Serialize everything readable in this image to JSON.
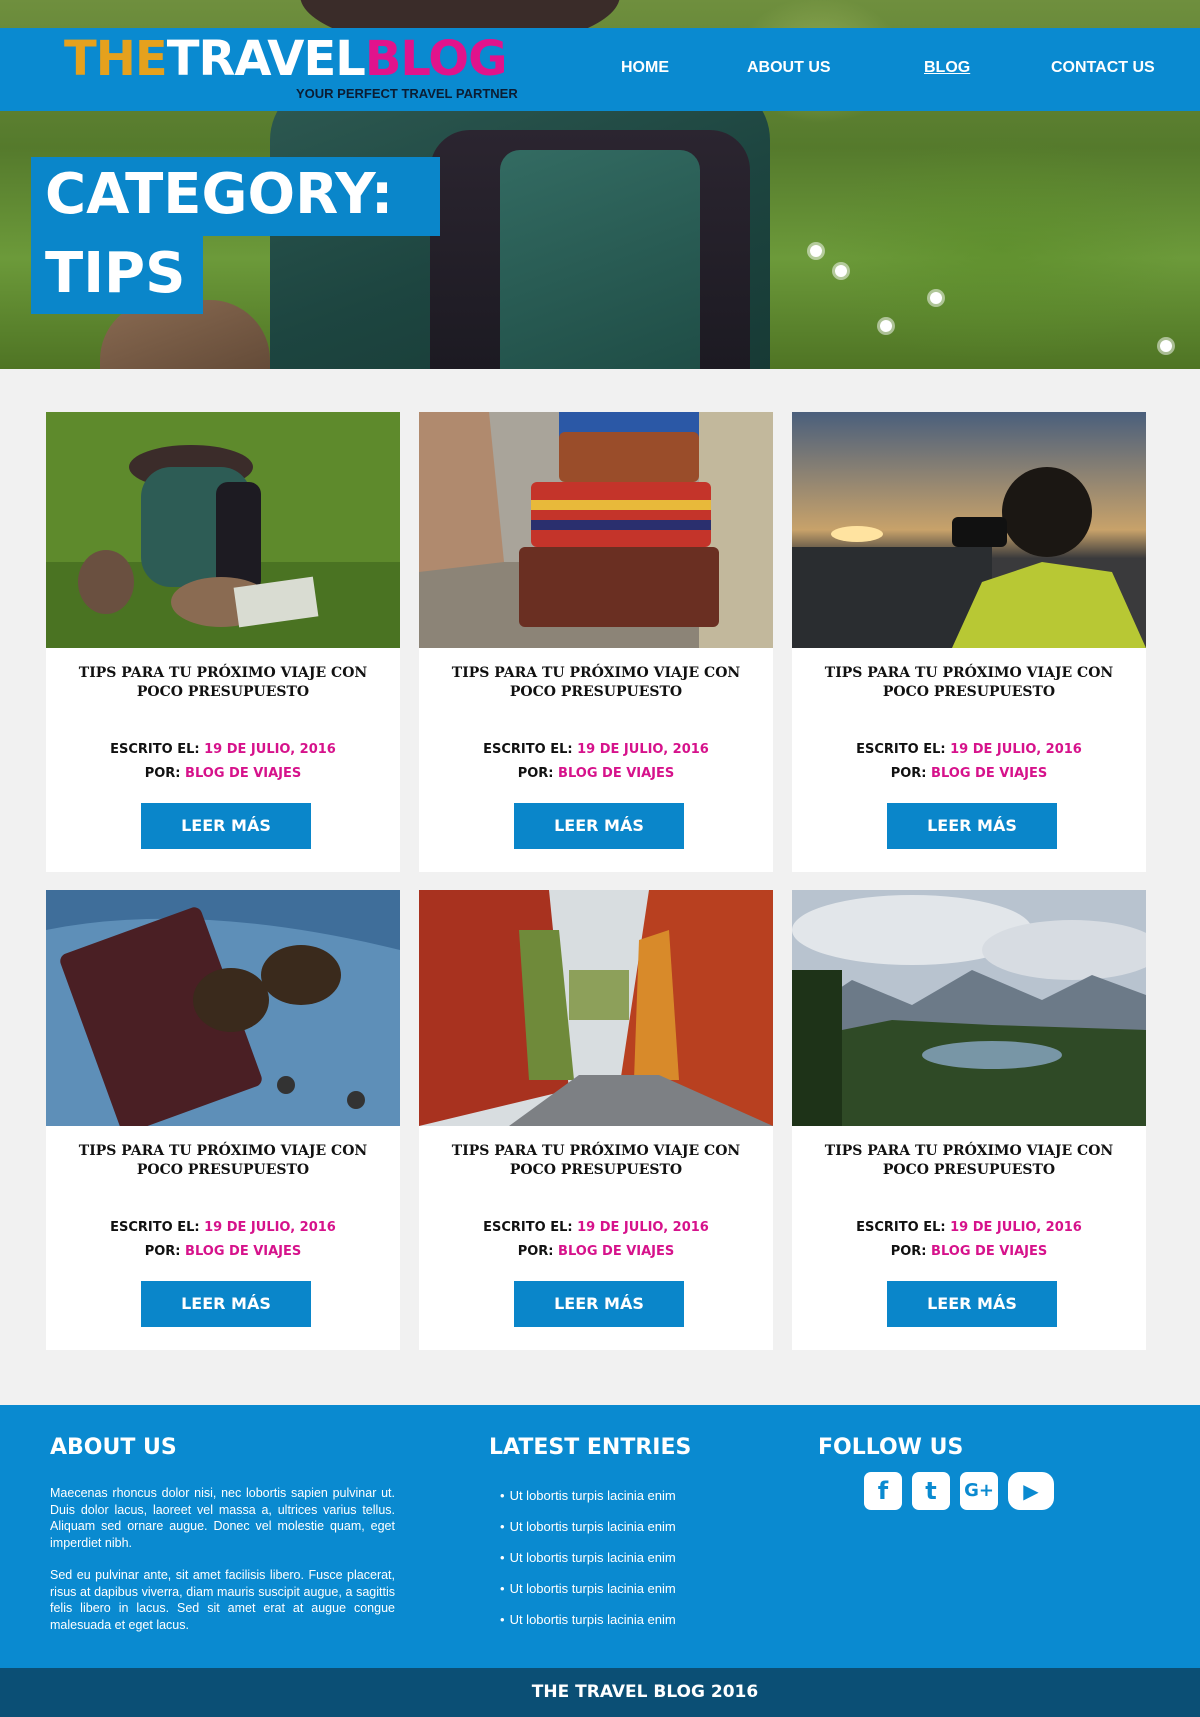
{
  "colors": {
    "primary_blue": "#0a8ad0",
    "dark_footer": "#0b4f75",
    "accent_pink": "#d6128b",
    "logo_gold": "#e5a11d",
    "logo_pink": "#e1138c"
  },
  "header": {
    "logo": {
      "the": "THE",
      "travel": "TRAVEL",
      "blog": "BLOG",
      "tagline": "YOUR PERFECT TRAVEL PARTNER"
    },
    "nav": [
      {
        "label": "HOME",
        "active": false
      },
      {
        "label": "ABOUT US",
        "active": false
      },
      {
        "label": "BLOG",
        "active": true
      },
      {
        "label": "CONTACT US",
        "active": false
      }
    ]
  },
  "hero": {
    "line1": "CATEGORY:",
    "line2": "TIPS"
  },
  "posts": [
    {
      "title": "TIPS PARA TU PRÓXIMO VIAJE  CON POCO PRESUPUESTO",
      "written_label": "ESCRITO EL:",
      "date": "19 DE JULIO, 2016",
      "by_label": "POR:",
      "author": "BLOG DE VIAJES",
      "button": "LEER MÁS",
      "image_icon": "backpack-boots-photo"
    },
    {
      "title": "TIPS PARA TU PRÓXIMO VIAJE  CON POCO PRESUPUESTO",
      "written_label": "ESCRITO EL:",
      "date": "19 DE JULIO, 2016",
      "by_label": "POR:",
      "author": "BLOG DE VIAJES",
      "button": "LEER MÁS",
      "image_icon": "suitcases-photo"
    },
    {
      "title": "TIPS PARA TU PRÓXIMO VIAJE  CON POCO PRESUPUESTO",
      "written_label": "ESCRITO EL:",
      "date": "19 DE JULIO, 2016",
      "by_label": "POR:",
      "author": "BLOG DE VIAJES",
      "button": "LEER MÁS",
      "image_icon": "photographer-sunset-photo"
    },
    {
      "title": "TIPS PARA TU PRÓXIMO VIAJE  CON POCO PRESUPUESTO",
      "written_label": "ESCRITO EL:",
      "date": "19 DE JULIO, 2016",
      "by_label": "POR:",
      "author": "BLOG DE VIAJES",
      "button": "LEER MÁS",
      "image_icon": "passport-sunglasses-photo"
    },
    {
      "title": "TIPS PARA TU PRÓXIMO VIAJE  CON POCO PRESUPUESTO",
      "written_label": "ESCRITO EL:",
      "date": "19 DE JULIO, 2016",
      "by_label": "POR:",
      "author": "BLOG DE VIAJES",
      "button": "LEER MÁS",
      "image_icon": "autumn-road-photo"
    },
    {
      "title": "TIPS PARA TU PRÓXIMO VIAJE  CON POCO PRESUPUESTO",
      "written_label": "ESCRITO EL:",
      "date": "19 DE JULIO, 2016",
      "by_label": "POR:",
      "author": "BLOG DE VIAJES",
      "button": "LEER MÁS",
      "image_icon": "mountain-lake-photo"
    }
  ],
  "footer": {
    "about": {
      "heading": "ABOUT US",
      "p1": "Maecenas rhoncus dolor nisi, nec lobortis sapien pulvinar ut. Duis dolor lacus, laoreet vel massa a, ultrices varius tellus. Aliquam sed ornare augue. Donec vel molestie quam, eget imperdiet nibh.",
      "p2": "Sed eu pulvinar ante, sit amet facilisis libero. Fusce placerat, risus at dapibus viverra, diam mauris suscipit augue, a sagittis felis libero in lacus. Sed sit amet erat at augue congue malesuada et eget lacus."
    },
    "latest": {
      "heading": "LATEST ENTRIES",
      "items": [
        "Ut lobortis turpis lacinia enim",
        "Ut lobortis turpis lacinia enim",
        "Ut lobortis turpis lacinia enim",
        "Ut lobortis turpis lacinia enim",
        "Ut lobortis turpis lacinia enim"
      ]
    },
    "follow": {
      "heading": "FOLLOW US",
      "icons": [
        {
          "name": "facebook-icon",
          "glyph": "f"
        },
        {
          "name": "twitter-icon",
          "glyph": "t"
        },
        {
          "name": "google-plus-icon",
          "glyph": "G+"
        },
        {
          "name": "youtube-icon",
          "glyph": "▶"
        }
      ]
    },
    "copyright": "THE TRAVEL BLOG 2016"
  }
}
